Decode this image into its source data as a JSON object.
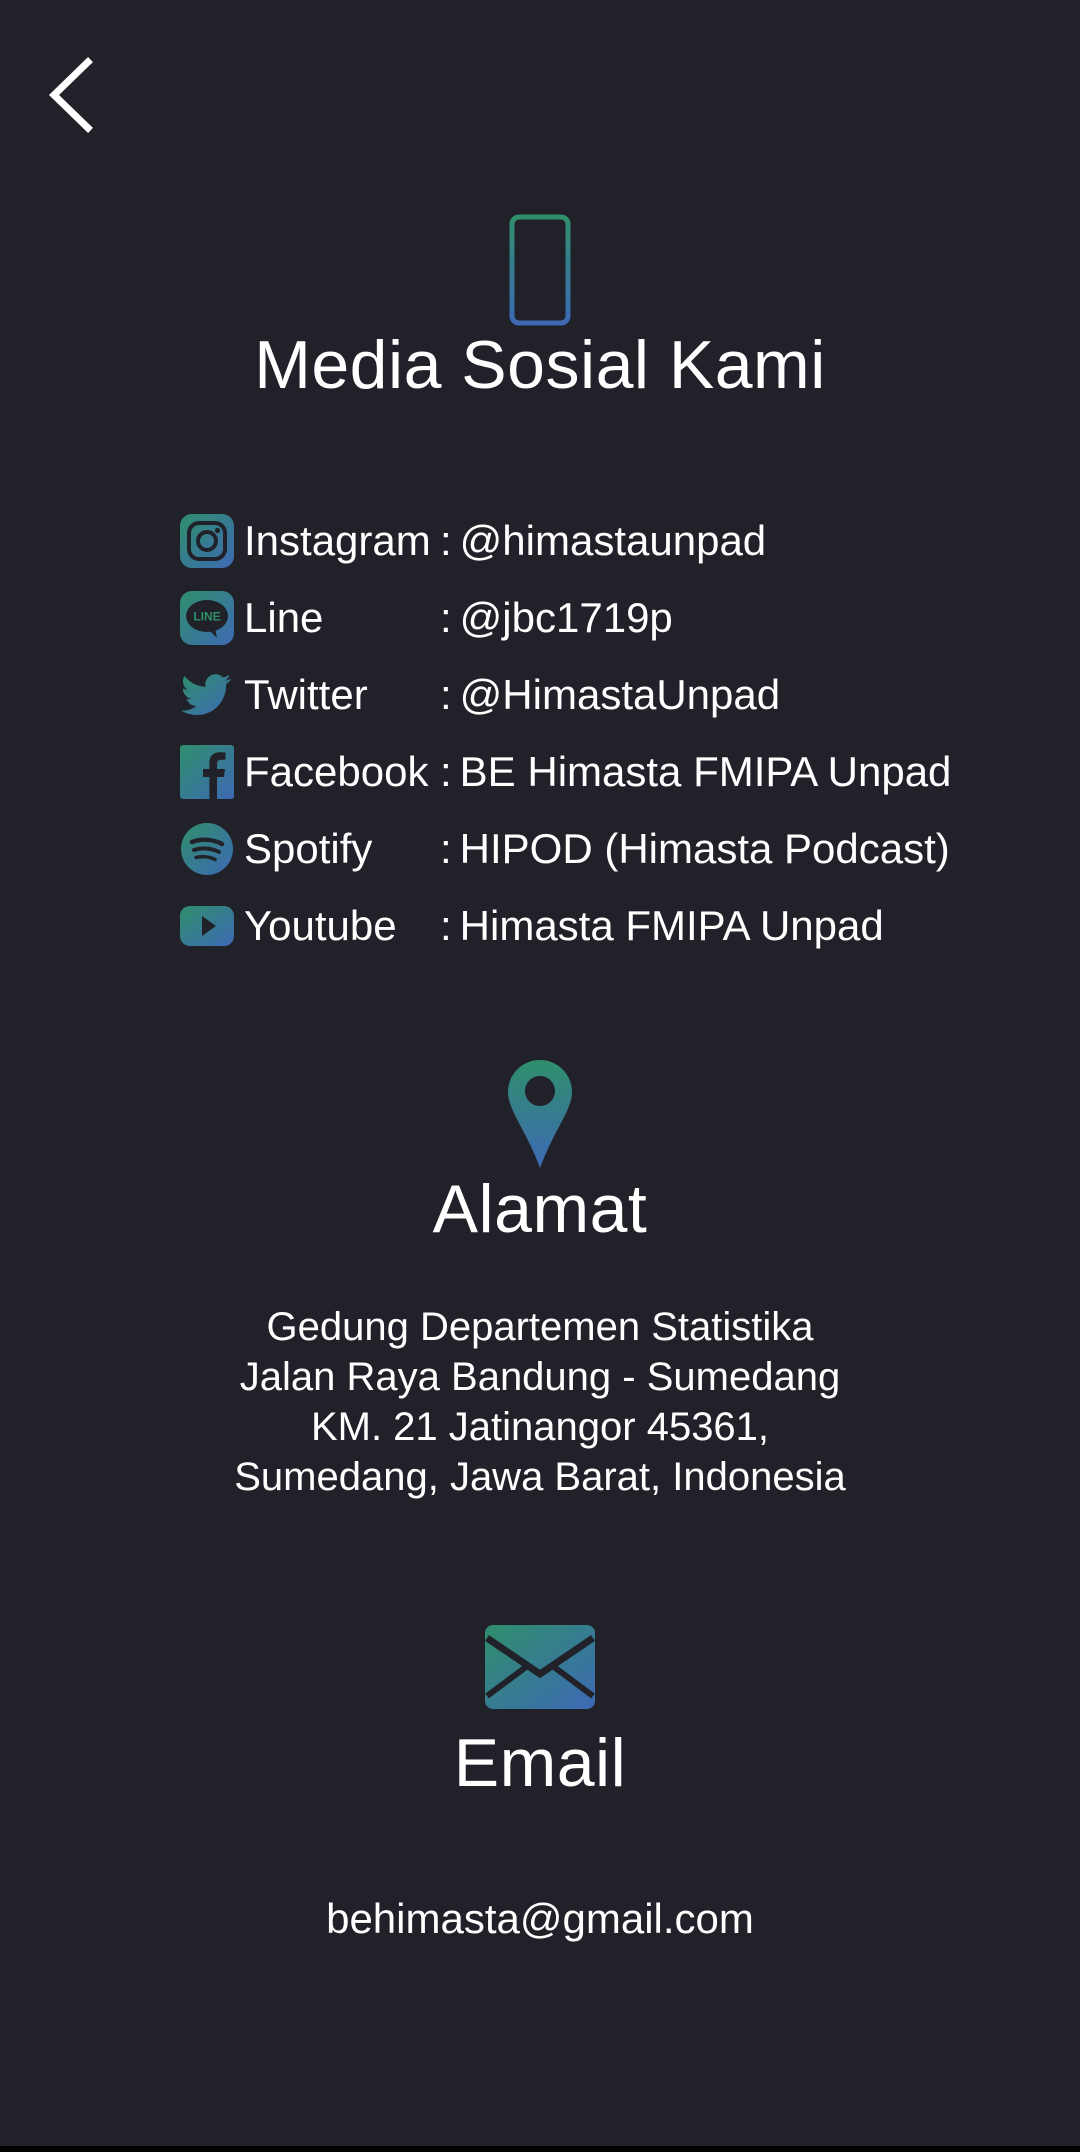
{
  "colors": {
    "background": "#212229",
    "text": "#ffffff",
    "gradient_start": "#2f8f6b",
    "gradient_end": "#3d69b4"
  },
  "header": {
    "back_icon": "chevron-left-icon"
  },
  "social": {
    "icon": "smartphone-icon",
    "title": "Media Sosial Kami",
    "separator": ":",
    "items": [
      {
        "icon": "instagram-icon",
        "name": "Instagram",
        "value": "@himastaunpad"
      },
      {
        "icon": "line-icon",
        "name": "Line",
        "value": "@jbc1719p"
      },
      {
        "icon": "twitter-icon",
        "name": "Twitter",
        "value": "@HimastaUnpad"
      },
      {
        "icon": "facebook-icon",
        "name": "Facebook",
        "value": "BE Himasta FMIPA Unpad"
      },
      {
        "icon": "spotify-icon",
        "name": "Spotify",
        "value": "HIPOD (Himasta Podcast)"
      },
      {
        "icon": "youtube-icon",
        "name": "Youtube",
        "value": "Himasta FMIPA Unpad"
      }
    ]
  },
  "address": {
    "icon": "map-pin-icon",
    "title": "Alamat",
    "lines": [
      "Gedung Departemen Statistika",
      "Jalan Raya Bandung - Sumedang",
      "KM. 21 Jatinangor 45361,",
      "Sumedang, Jawa Barat, Indonesia"
    ]
  },
  "email": {
    "icon": "envelope-icon",
    "title": "Email",
    "address": "behimasta@gmail.com"
  }
}
